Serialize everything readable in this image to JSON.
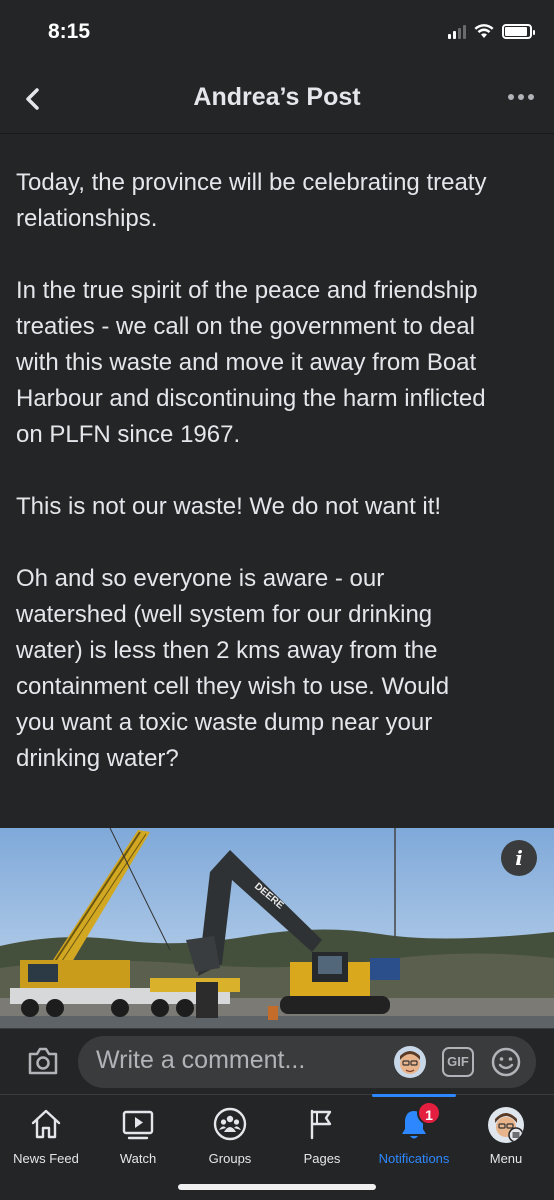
{
  "status": {
    "time": "8:15",
    "battery_level": 0.9,
    "signal_bars": 2,
    "signal_total": 4
  },
  "nav": {
    "title": "Andrea’s Post",
    "back_icon": "chevron-left-icon",
    "more_icon": "ellipsis-icon"
  },
  "post": {
    "paragraphs": [
      "Today, the province will be celebrating treaty\nrelationships.",
      "In the true spirit of the peace and friendship\ntreaties - we call on the government to deal\nwith this waste and move it away from Boat\nHarbour and discontinuing the harm inflicted\non PLFN since 1967.",
      "This is not our waste! We do not want it!",
      "Oh and so everyone is aware - our\nwatershed (well system for our drinking\nwater) is less then 2 kms away from the\ncontainment cell they wish to use. Would\nyou want a toxic waste dump near your\ndrinking water?"
    ],
    "image": {
      "excavator_brand": "DEERE",
      "info_glyph": "i"
    }
  },
  "comment": {
    "placeholder": "Write a comment...",
    "gif_label": "GIF"
  },
  "tabs": [
    {
      "label": "News Feed",
      "icon": "home-icon",
      "active": false
    },
    {
      "label": "Watch",
      "icon": "watch-icon",
      "active": false
    },
    {
      "label": "Groups",
      "icon": "groups-icon",
      "active": false
    },
    {
      "label": "Pages",
      "icon": "flag-icon",
      "active": false
    },
    {
      "label": "Notifications",
      "icon": "bell-icon",
      "active": true,
      "badge": "1"
    },
    {
      "label": "Menu",
      "icon": "menu-avatar-icon",
      "active": false
    }
  ],
  "colors": {
    "background": "#242526",
    "accent": "#2d88ff",
    "badge": "#e41e3f",
    "text": "#e4e6eb"
  }
}
